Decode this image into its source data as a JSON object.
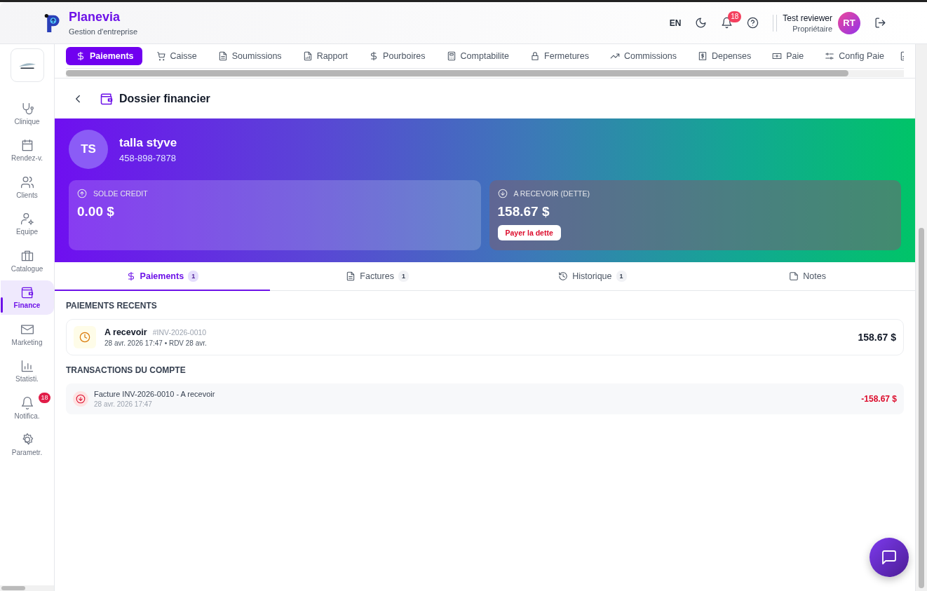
{
  "app": {
    "name": "Planevia",
    "subtitle": "Gestion d'entreprise"
  },
  "header": {
    "language": "EN",
    "notifications": "18",
    "user": {
      "name": "Test reviewer",
      "role": "Propriétaire",
      "initials": "RT"
    }
  },
  "top_tabs": [
    {
      "label": "Paiements",
      "selected": true
    },
    {
      "label": "Caisse",
      "selected": false
    },
    {
      "label": "Soumissions",
      "selected": false
    },
    {
      "label": "Rapport",
      "selected": false
    },
    {
      "label": "Pourboires",
      "selected": false
    },
    {
      "label": "Comptabilite",
      "selected": false
    },
    {
      "label": "Fermetures",
      "selected": false
    },
    {
      "label": "Commissions",
      "selected": false
    },
    {
      "label": "Depenses",
      "selected": false
    },
    {
      "label": "Paie",
      "selected": false
    },
    {
      "label": "Config Paie",
      "selected": false
    }
  ],
  "sidebar": [
    {
      "label": "Clinique",
      "selected": false
    },
    {
      "label": "Rendez-v.",
      "selected": false
    },
    {
      "label": "Clients",
      "selected": false
    },
    {
      "label": "Equipe",
      "selected": false
    },
    {
      "label": "Catalogue",
      "selected": false
    },
    {
      "label": "Finance",
      "selected": true
    },
    {
      "label": "Marketing",
      "selected": false
    },
    {
      "label": "Statisti.",
      "selected": false
    },
    {
      "label": "Notifica.",
      "selected": false,
      "badge": "18"
    },
    {
      "label": "Parametr.",
      "selected": false
    }
  ],
  "page_title": "Dossier financier",
  "client": {
    "initials": "TS",
    "name": "talla styve",
    "phone": "458-898-7878"
  },
  "balances": [
    {
      "kind": "credit",
      "label": "SOLDE CREDIT",
      "amount": "0.00 $"
    },
    {
      "kind": "debt",
      "label": "A RECEVOIR (DETTE)",
      "amount": "158.67 $",
      "action": "Payer la dette"
    }
  ],
  "detail_tabs": [
    {
      "label": "Paiements",
      "count": "1",
      "selected": true
    },
    {
      "label": "Factures",
      "count": "1",
      "selected": false
    },
    {
      "label": "Historique",
      "count": "1",
      "selected": false
    },
    {
      "label": "Notes",
      "selected": false
    }
  ],
  "recent_payments": {
    "title": "PAIEMENTS RECENTS",
    "items": [
      {
        "status": "A recevoir",
        "reference": "#INV-2026-0010",
        "meta": "28 avr. 2026 17:47 • RDV 28 avr.",
        "amount": "158.67 $"
      }
    ]
  },
  "transactions": {
    "title": "TRANSACTIONS DU COMPTE",
    "items": [
      {
        "kind": "debit",
        "description": "Facture INV-2026-0010 - A recevoir",
        "date": "28 avr. 2026 17:47",
        "amount": "-158.67 $"
      }
    ]
  }
}
